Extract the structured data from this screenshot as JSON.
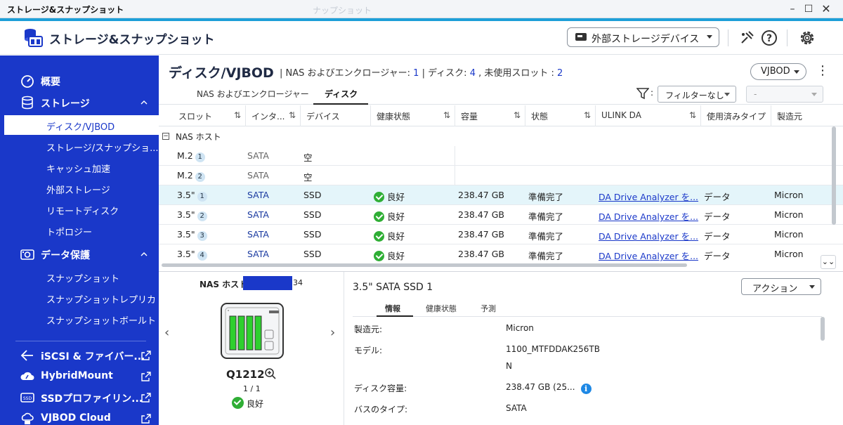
{
  "window": {
    "title": "ストレージ&スナップショット",
    "ghost_title": "ナップショット"
  },
  "app": {
    "name": "ストレージ&スナップショット"
  },
  "header": {
    "external_device": "外部ストレージデバイス"
  },
  "sidebar": {
    "items": [
      {
        "label": "概要"
      },
      {
        "label": "ストレージ"
      },
      {
        "label": "データ保護"
      },
      {
        "label": "iSCSI & ファイバー..."
      },
      {
        "label": "HybridMount"
      },
      {
        "label": "SSDプロファイリン..."
      },
      {
        "label": "VJBOD Cloud"
      }
    ],
    "storage_sub": [
      "ディスク/VJBOD",
      "ストレージ/スナップショ...",
      "キャッシュ加速",
      "外部ストレージ",
      "リモートディスク",
      "トポロジー"
    ],
    "protect_sub": [
      "スナップショット",
      "スナップショットレプリカ",
      "スナップショットボールト"
    ]
  },
  "main": {
    "title": "ディスク/VJBOD",
    "summary": {
      "sep": "|",
      "nas_label": "NAS およびエンクロージャー:",
      "nas_count": "1",
      "disk_label": "| ディスク:",
      "disk_count": "4",
      "unused_label": ", 未使用スロット :",
      "unused_count": "2"
    },
    "vjbod_button": "VJBOD",
    "tabs": [
      "NAS およびエンクロージャー",
      "ディスク"
    ],
    "filter": {
      "colon": ":",
      "value": "フィルターなし",
      "second": "-"
    }
  },
  "table": {
    "columns": [
      "スロット",
      "インタ...",
      "デバイス",
      "健康状態",
      "容量",
      "状態",
      "ULINK DA",
      "使用済みタイプ",
      "製造元"
    ],
    "sort_icon": "⇅",
    "group": {
      "label": "NAS ホスト",
      "toggle": "−"
    },
    "rows": [
      {
        "slot": "M.2",
        "num": "1",
        "iface": "SATA",
        "device": "空"
      },
      {
        "slot": "M.2",
        "num": "2",
        "iface": "SATA",
        "device": "空"
      },
      {
        "slot": "3.5\"",
        "num": "1",
        "iface": "SATA",
        "device": "SSD",
        "health": "良好",
        "capacity": "238.47 GB",
        "status": "準備完了",
        "ulink": "DA Drive Analyzer を...",
        "usage": "データ",
        "vendor": "Micron"
      },
      {
        "slot": "3.5\"",
        "num": "2",
        "iface": "SATA",
        "device": "SSD",
        "health": "良好",
        "capacity": "238.47 GB",
        "status": "準備完了",
        "ulink": "DA Drive Analyzer を...",
        "usage": "データ",
        "vendor": "Micron"
      },
      {
        "slot": "3.5\"",
        "num": "3",
        "iface": "SATA",
        "device": "SSD",
        "health": "良好",
        "capacity": "238.47 GB",
        "status": "準備完了",
        "ulink": "DA Drive Analyzer を...",
        "usage": "データ",
        "vendor": "Micron"
      },
      {
        "slot": "3.5\"",
        "num": "4",
        "iface": "SATA",
        "device": "SSD",
        "health": "良好",
        "capacity": "238.47 GB",
        "status": "準備完了",
        "ulink": "DA Drive Analyzer を...",
        "usage": "データ",
        "vendor": "Micron"
      }
    ]
  },
  "detail": {
    "nas_label": "NAS ホスト",
    "nas_suffix": "34",
    "model": "Q1212",
    "page": "1 / 1",
    "status": "良好",
    "disk_title": "3.5\" SATA SSD 1",
    "action": "アクション",
    "subtabs": [
      "情報",
      "健康状態",
      "予測"
    ],
    "props": [
      {
        "label": "製造元:",
        "value": "Micron"
      },
      {
        "label": "モデル:",
        "value": "1100_MTFDDAK256TB",
        "value2": "N"
      },
      {
        "label": "ディスク容量:",
        "value": "238.47 GB (25..."
      },
      {
        "label": "バスのタイプ:",
        "value": "SATA"
      }
    ]
  },
  "colors": {
    "sidebar": "#1a38c9",
    "accent": "#1d9fd8",
    "ok": "#2fae35",
    "selected_row": "#e4f5fa"
  },
  "icons": [
    "storage-app-icon",
    "external-drive-icon",
    "debug-icon",
    "help-icon",
    "gear-icon",
    "dashboard-icon",
    "database-icon",
    "snapshot-icon",
    "iscsi-icon",
    "cloud-mount-icon",
    "ssd-icon",
    "vjbod-icon",
    "filter-icon",
    "zoom-icon",
    "info-icon"
  ]
}
